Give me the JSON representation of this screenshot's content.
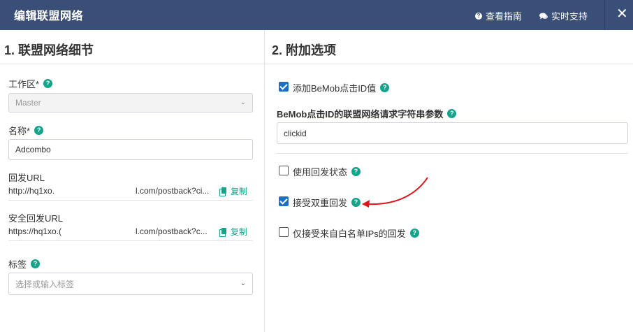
{
  "header": {
    "title": "编辑联盟网络",
    "help_label": "查看指南",
    "support_label": "实时支持",
    "close_label": "✕"
  },
  "left": {
    "section_title": "1. 联盟网络细节",
    "workspace": {
      "label": "工作区*",
      "value": "Master"
    },
    "name": {
      "label": "名称*",
      "value": "Adcombo"
    },
    "postback": {
      "label": "回发URL",
      "url_start": "http://hq1xo.",
      "url_end": "l.com/postback?ci...",
      "copy_label": "复制"
    },
    "secure_postback": {
      "label": "安全回发URL",
      "url_start": "https://hq1xo.(",
      "url_end": "l.com/postback?c...",
      "copy_label": "复制"
    },
    "tags": {
      "label": "标签",
      "placeholder": "选择或输入标签"
    }
  },
  "right": {
    "section_title": "2. 附加选项",
    "add_click_id": {
      "label": "添加BeMob点击ID值",
      "checked": true
    },
    "param": {
      "label": "BeMob点击ID的联盟网络请求字符串参数",
      "value": "clickid"
    },
    "use_postback_status": {
      "label": "使用回发状态",
      "checked": false
    },
    "accept_duplicate": {
      "label": "接受双重回发",
      "checked": true
    },
    "whitelist_only": {
      "label": "仅接受来自白名单IPs的回发",
      "checked": false
    }
  },
  "colors": {
    "header_bg": "#3a4f78",
    "accent": "#14a38b",
    "checkbox": "#1d6fc4",
    "arrow": "#e0141b"
  },
  "icons": {
    "help": "question-circle-icon",
    "support": "chat-icon",
    "close": "close-icon",
    "copy": "copy-icon",
    "dropdown": "chevron-down-icon"
  }
}
